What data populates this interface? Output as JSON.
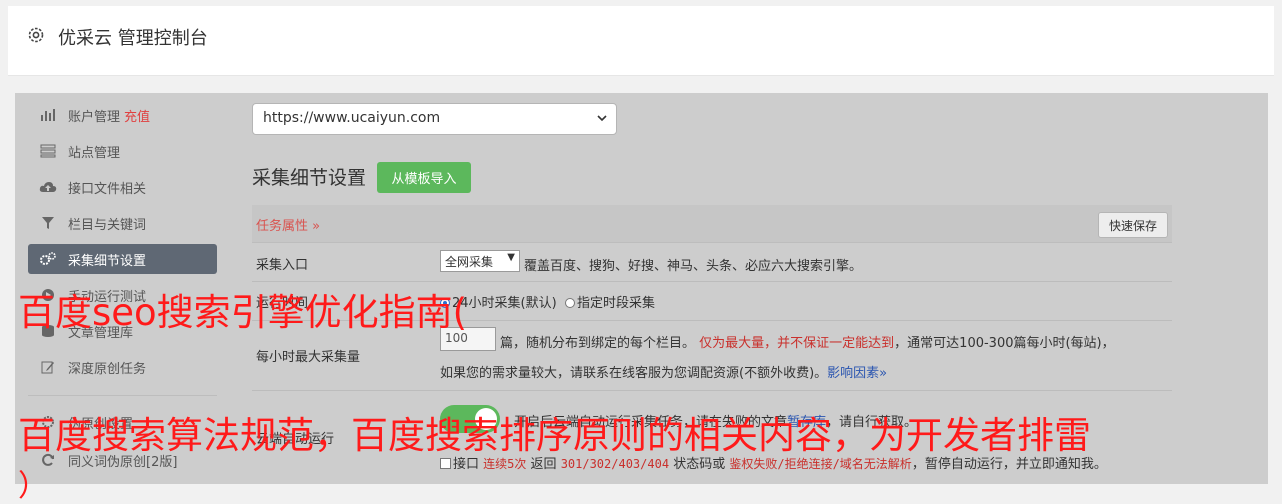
{
  "app": {
    "title": "优采云 管理控制台"
  },
  "sidebar": {
    "items": [
      {
        "label": "账户管理",
        "badge": "充值",
        "icon": "bar-chart-icon"
      },
      {
        "label": "站点管理",
        "icon": "server-icon"
      },
      {
        "label": "接口文件相关",
        "icon": "cloud-upload-icon"
      },
      {
        "label": "栏目与关键词",
        "icon": "filter-icon"
      },
      {
        "label": "采集细节设置",
        "icon": "gears-icon",
        "active": true
      },
      {
        "label": "手动运行测试",
        "icon": "play-icon"
      },
      {
        "label": "文章管理库",
        "icon": "database-icon"
      },
      {
        "label": "深度原创任务",
        "icon": "edit-icon"
      },
      {
        "label": "伪原创设置",
        "icon": "settings-icon"
      },
      {
        "label": "同义词伪原创[2版]",
        "icon": "refresh-icon"
      }
    ]
  },
  "main": {
    "site_select": "https://www.ucaiyun.com",
    "section_title": "采集细节设置",
    "import_button": "从模板导入",
    "task_attr": "任务属性",
    "quick_save": "快速保存",
    "entry": {
      "label": "采集入口",
      "select": "全网采集",
      "desc": "覆盖百度、搜狗、好搜、神马、头条、必应六大搜索引擎。"
    },
    "runtime": {
      "label": "运行时间",
      "opt1": "24小时采集(默认)",
      "opt2": "指定时段采集"
    },
    "max_per_hour": {
      "label": "每小时最大采集量",
      "value": "100",
      "text1": "篇，随机分布到绑定的每个栏目。",
      "warn": "仅为最大量，并不保证一定能达到",
      "text2": "，通常可达100-300篇每小时(每站)，",
      "text3": "如果您的需求量较大，请联系在线客服为您调配资源(不额外收费)。",
      "link": "影响因素"
    },
    "cloud": {
      "label": "云端自动运行",
      "text1": "开启后云端自动运行采集任务，请在失败的文章",
      "link": "暂存库",
      "text2": "，请自行获取。"
    },
    "notify": {
      "text1": "接口",
      "code1": "连续5次",
      "text2": "返回",
      "code2": "301/302/403/404",
      "text3": "状态码或",
      "code3": "鉴权失败/拒绝连接/域名无法解析",
      "text4": "，暂停自动运行，并立即通知我。"
    }
  },
  "overlays": {
    "line1": "百度seo搜索引擎优化指南(",
    "line2": "百度搜索算法规范，百度搜索排序原则的相关内容，为开发者排雷",
    "line3": "）"
  },
  "colors": {
    "accent": "#5cb85c",
    "danger": "#d9534f",
    "overlay": "#ff1a1a",
    "active": "#5f6874"
  }
}
